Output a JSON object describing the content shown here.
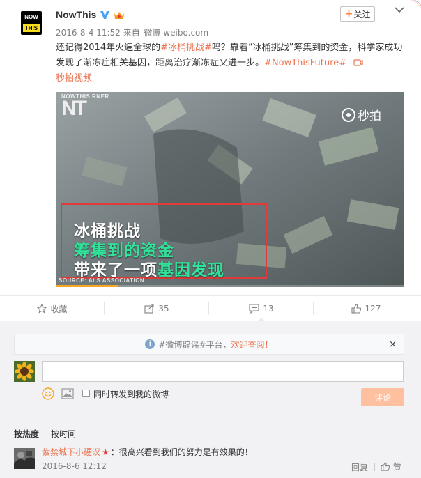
{
  "post": {
    "avatar_line1": "NOW",
    "avatar_line2": "THIS",
    "username": "NowThis",
    "meta_time": "2016-8-4 11:52",
    "meta_from": "来自",
    "meta_source": "微博 weibo.com",
    "follow_label": "关注",
    "text_pre": "还记得2014年火遍全球的",
    "topic1": "#冰桶挑战#",
    "text_mid": "吗？靠着“冰桶挑战”筹集到的资金，科学家成功发现了渐冻症相关基因，距离治疗渐冻症又进一步。",
    "topic2": "#NowThisFuture#",
    "video_link": "秒拍视频"
  },
  "video": {
    "logo_small": "NOWTHIS",
    "logo_sub": "RNER",
    "logo_big": "NT",
    "watermark": "秒拍",
    "caption_line1": "冰桶挑战",
    "caption_line2": "筹集到的资金",
    "caption_line3_pre": "带来了一项",
    "caption_line3_hl": "基因发现",
    "source": "SOURCE: ALS ASSOCIATION",
    "progress": 0.18
  },
  "actions": {
    "favorite_label": "收藏",
    "repost_count": "35",
    "comment_count": "13",
    "like_count": "127"
  },
  "comments": {
    "notice_pre": "#微博辟谣#平台，",
    "notice_hot": "欢迎查阅！",
    "notice_close": "×",
    "repost_label": "同时转发到我的微博",
    "comment_button": "评论",
    "sort_hot": "按热度",
    "sort_time": "按时间",
    "items": [
      {
        "user": "紫禁城下小硬汉",
        "star": "★",
        "text": "：很高兴看到我们的努力是有效果的！",
        "time": "2016-8-6 12:12",
        "reply": "回复",
        "like": "赞"
      }
    ]
  },
  "colors": {
    "accent": "#eb7350",
    "caption_green": "#32e29a",
    "caption_box": "#e03a3a"
  }
}
